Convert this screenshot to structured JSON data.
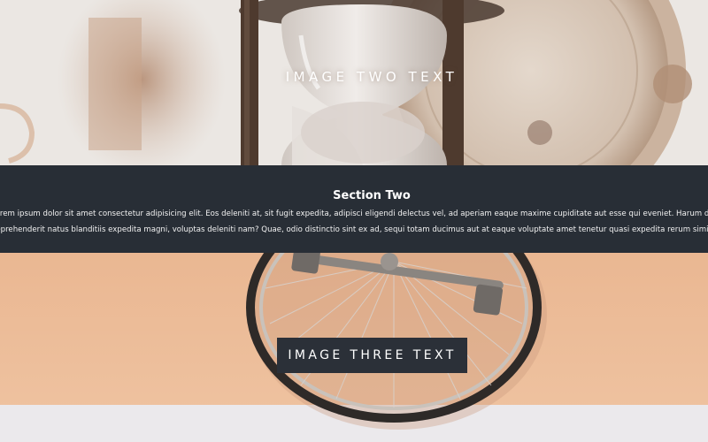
{
  "image_two": {
    "caption": "IMAGE TWO TEXT"
  },
  "section_two": {
    "title": "Section Two",
    "body_lines": [
      "Lorem ipsum dolor sit amet consectetur adipisicing elit. Eos deleniti at, sit fugit expedita, adipisci eligendi delectus vel, ad aperiam eaque maxime cupiditate aut esse qui eveniet. Harum dolore pariatur tempore libero facere",
      "reprehenderit natus blanditiis expedita magni, voluptas deleniti nam? Quae, odio distinctio sint ex ad, sequi totam ducimus aut at eaque voluptate amet tenetur quasi expedita rerum similique. Veniam modi sunt"
    ]
  },
  "image_three": {
    "button_label": "IMAGE THREE TEXT"
  },
  "colors": {
    "section_background": "#282e36",
    "button_background": "#2b3038",
    "wall_peach": "#ecbc97",
    "text_light": "#ffffff"
  },
  "icons": {
    "image_two": "hourglass-clock-photo",
    "image_three": "bicycle-wheel-wrench-photo"
  }
}
